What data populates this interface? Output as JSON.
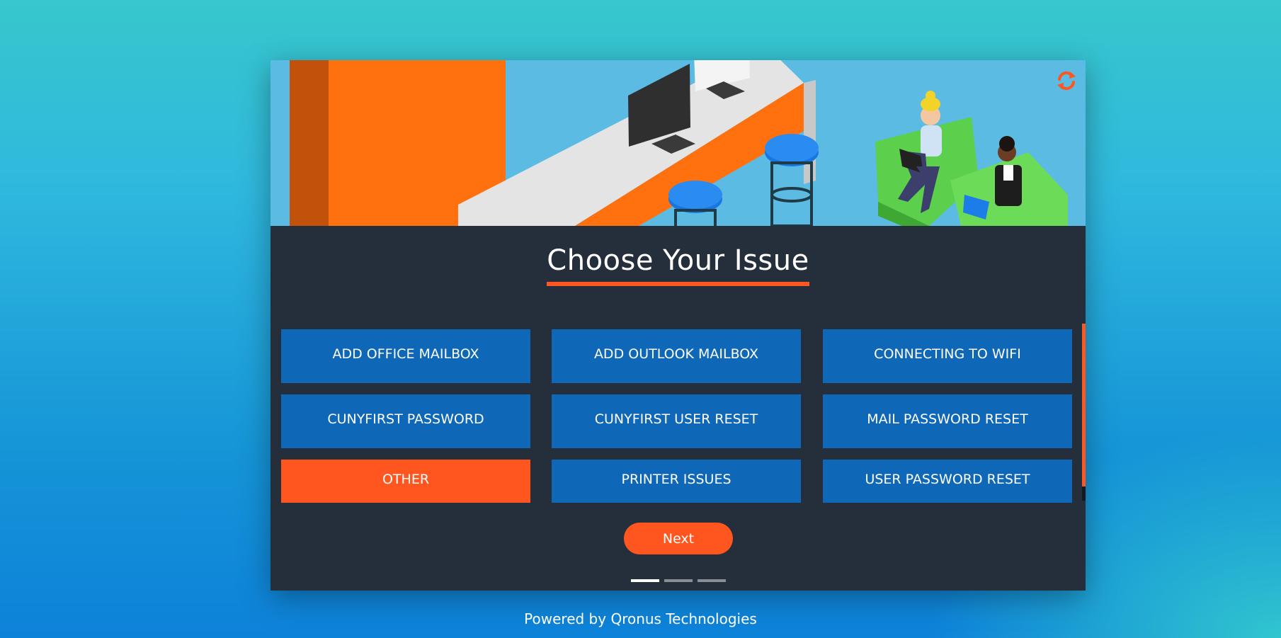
{
  "colors": {
    "accent": "#ff561f",
    "button_blue": "#0f67b8",
    "panel": "#252f3c"
  },
  "header": {
    "refresh_icon": "refresh-icon"
  },
  "main": {
    "title": "Choose Your Issue",
    "issues": [
      {
        "label": "ADD OFFICE MAILBOX",
        "selected": false
      },
      {
        "label": "ADD OUTLOOK MAILBOX",
        "selected": false
      },
      {
        "label": "CONNECTING TO WIFI",
        "selected": false
      },
      {
        "label": "CUNYFIRST PASSWORD",
        "selected": false
      },
      {
        "label": "CUNYFIRST USER RESET",
        "selected": false
      },
      {
        "label": "MAIL PASSWORD RESET",
        "selected": false
      },
      {
        "label": "OTHER",
        "selected": true
      },
      {
        "label": "PRINTER ISSUES",
        "selected": false
      },
      {
        "label": "USER PASSWORD RESET",
        "selected": false
      }
    ],
    "next_label": "Next",
    "pager": {
      "count": 3,
      "active": 0
    }
  },
  "footer": {
    "text": "Powered by Qronus Technologies"
  }
}
